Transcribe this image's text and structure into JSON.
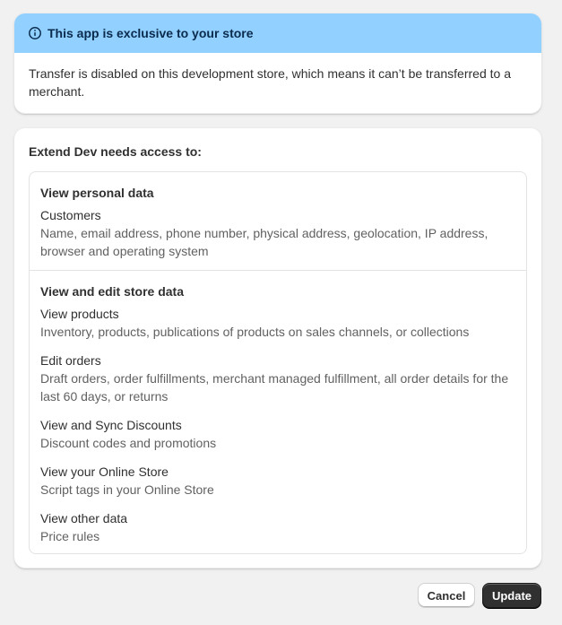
{
  "banner": {
    "title": "This app is exclusive to your store",
    "body": "Transfer is disabled on this development store, which means it can’t be transferred to a merchant.",
    "icon": "info-icon",
    "color": "#91d0ff"
  },
  "access": {
    "title": "Extend Dev needs access to:",
    "sections": [
      {
        "title": "View personal data",
        "scopes": [
          {
            "name": "Customers",
            "description": "Name, email address, phone number, physical address, geolocation, IP address, browser and operating system"
          }
        ]
      },
      {
        "title": "View and edit store data",
        "scopes": [
          {
            "name": "View products",
            "description": "Inventory, products, publications of products on sales channels, or collections"
          },
          {
            "name": "Edit orders",
            "description": "Draft orders, order fulfillments, merchant managed fulfillment, all order details for the last 60 days, or returns"
          },
          {
            "name": "View and Sync Discounts",
            "description": "Discount codes and promotions"
          },
          {
            "name": "View your Online Store",
            "description": "Script tags in your Online Store"
          },
          {
            "name": "View other data",
            "description": "Price rules"
          }
        ]
      }
    ]
  },
  "footer": {
    "cancel_label": "Cancel",
    "update_label": "Update"
  }
}
